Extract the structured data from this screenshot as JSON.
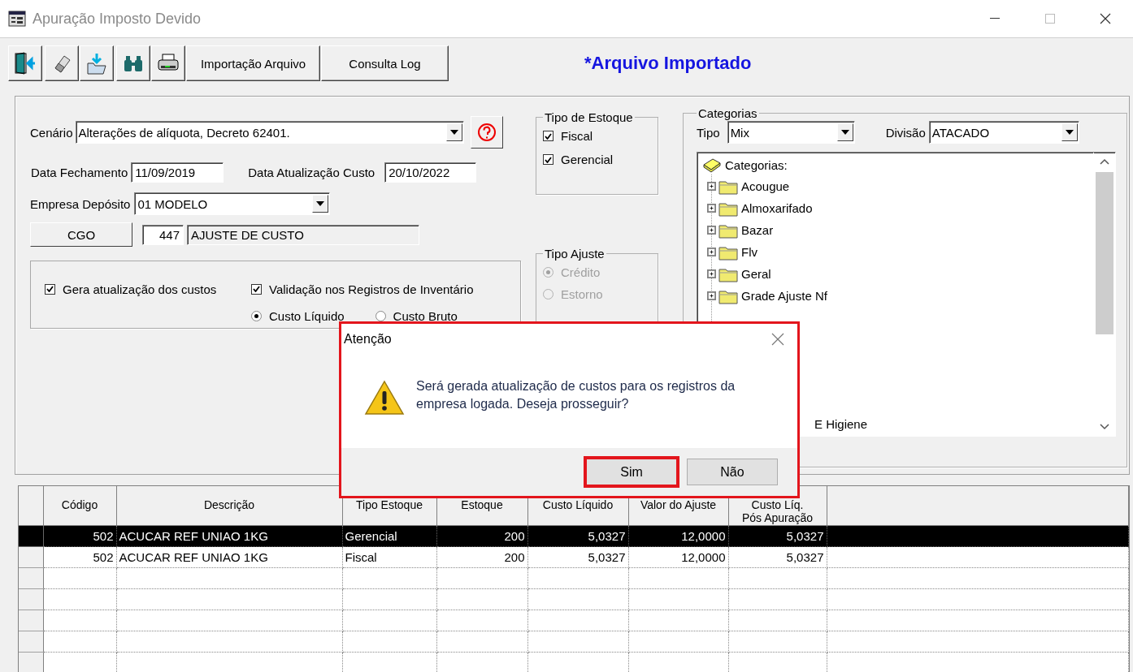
{
  "window": {
    "title": "Apuração Imposto Devido"
  },
  "toolbar": {
    "icon_buttons": [
      {
        "kind": "exit"
      },
      {
        "kind": "eraser"
      },
      {
        "kind": "import"
      },
      {
        "kind": "binoculars"
      },
      {
        "kind": "printer"
      }
    ],
    "buttons": [
      "Importação Arquivo",
      "Consulta Log"
    ],
    "status_title": "*Arquivo Importado"
  },
  "form": {
    "cenario": {
      "label": "Cenário",
      "value": "Alterações de alíquota, Decreto 62401."
    },
    "data_fechamento": {
      "label": "Data Fechamento",
      "value": "11/09/2019"
    },
    "data_atualizacao": {
      "label": "Data Atualização Custo",
      "value": "20/10/2022"
    },
    "empresa": {
      "label": "Empresa Depósito",
      "value": "01 MODELO"
    },
    "cgo": {
      "button": "CGO",
      "code": "447",
      "description": "AJUSTE DE CUSTO"
    },
    "checkboxes": [
      {
        "label": "Gera atualização dos custos",
        "checked": true
      },
      {
        "label": "Validação nos Registros de Inventário",
        "checked": true
      }
    ],
    "radios": [
      {
        "label": "Custo Líquido",
        "selected": true
      },
      {
        "label": "Custo Bruto",
        "selected": false
      }
    ]
  },
  "tipo_estoque": {
    "title": "Tipo de Estoque",
    "items": [
      {
        "label": "Fiscal",
        "checked": true
      },
      {
        "label": "Gerencial",
        "checked": true
      }
    ]
  },
  "tipo_ajuste": {
    "title": "Tipo Ajuste",
    "items": [
      {
        "label": "Crédito",
        "selected": true,
        "disabled": true
      },
      {
        "label": "Estorno",
        "selected": false,
        "disabled": true
      }
    ]
  },
  "categorias": {
    "title": "Categorias",
    "tipo": {
      "label": "Tipo",
      "value": "Mix"
    },
    "divisao": {
      "label": "Divisão",
      "value": "ATACADO"
    },
    "tree": {
      "root": "Categorias:",
      "children": [
        {
          "label": "Acougue",
          "expanded": false,
          "kind": "node"
        },
        {
          "label": "Almoxarifado",
          "expanded": false,
          "kind": "node"
        },
        {
          "label": "Bazar",
          "expanded": false,
          "kind": "node"
        },
        {
          "label": "Flv",
          "expanded": false,
          "kind": "node"
        },
        {
          "label": "Geral",
          "expanded": false,
          "kind": "node"
        },
        {
          "label": "Grade Ajuste Nf",
          "expanded": false,
          "kind": "node"
        },
        {
          "label": "E Higiene",
          "kind": "clipped"
        }
      ]
    }
  },
  "grid": {
    "columns": [
      "Código",
      "Descrição",
      "Tipo Estoque",
      "Estoque",
      "Custo Líquido",
      "Valor do Ajuste",
      "Custo Líq.\nPós Apuração"
    ],
    "rows": [
      {
        "selected": true,
        "cells": [
          "502",
          "ACUCAR REF UNIAO 1KG",
          "Gerencial",
          "200",
          "5,0327",
          "12,0000",
          "5,0327"
        ]
      },
      {
        "selected": false,
        "cells": [
          "502",
          "ACUCAR REF UNIAO 1KG",
          "Fiscal",
          "200",
          "5,0327",
          "12,0000",
          "5,0327"
        ]
      }
    ]
  },
  "dialog": {
    "title": "Atenção",
    "highlighted": true,
    "message": "Será gerada atualização de custos para os registros da empresa logada. Deseja prosseguir?",
    "buttons": [
      {
        "label": "Sim",
        "highlighted": true
      },
      {
        "label": "Não",
        "highlighted": false
      }
    ]
  }
}
